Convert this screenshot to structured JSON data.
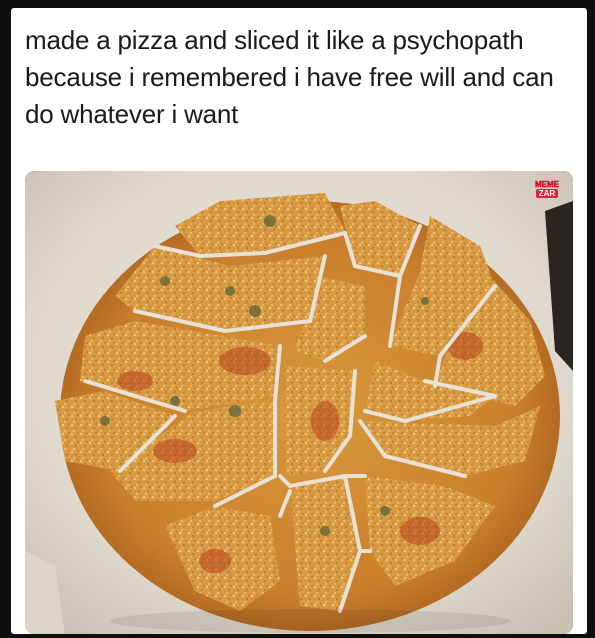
{
  "post": {
    "caption": "made a pizza and sliced it like a psychopath because i remembered i have free will and can do whatever i want"
  },
  "watermark": {
    "line1": "MEME",
    "line2": "ZAR"
  }
}
